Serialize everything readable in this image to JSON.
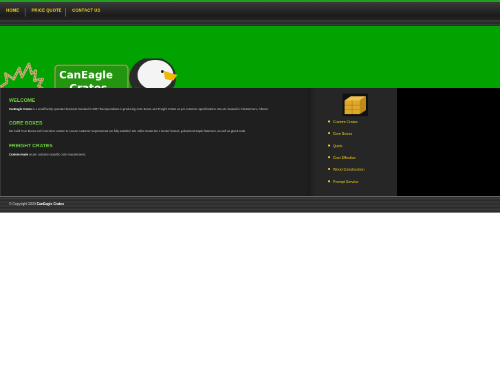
{
  "nav": {
    "items": [
      "HOME",
      "PRICE QUOTE",
      "CONTACT US"
    ]
  },
  "logo": {
    "line1": "CanEagle",
    "line2": "Crates"
  },
  "content": {
    "welcome": {
      "heading": "WELCOME",
      "bold": "CanEagle Crates",
      "text": " is a small family operated business founded in 2007 that specializes in producing Core Boxes and Freight Crates as per customer specifications. We are located in Chestermere, Alberta."
    },
    "core_boxes": {
      "heading": "CORE BOXES",
      "text": "We build Core Boxes and Core Bins custom to ensure customer requirements are fully satisfied. We utilize Grade No.1 lumber frames, galvanized staple fasteners, as well as glued ends."
    },
    "freight_crates": {
      "heading": "FREIGHT CRATES",
      "bold": "Custom-made",
      "text": " as per customer specific order requirements."
    }
  },
  "sidebar": {
    "items": [
      "Custom Crates",
      "Core Boxes",
      "Quick",
      "Cost Effective",
      "Wood Construction",
      "Prompt Service"
    ]
  },
  "footer": {
    "prefix": "© Copyright 2009 ",
    "brand": "CanEagle Crates"
  },
  "colors": {
    "brand_green": "#00a300",
    "heading_green": "#6cd33b",
    "nav_yellow": "#f3d21a"
  }
}
